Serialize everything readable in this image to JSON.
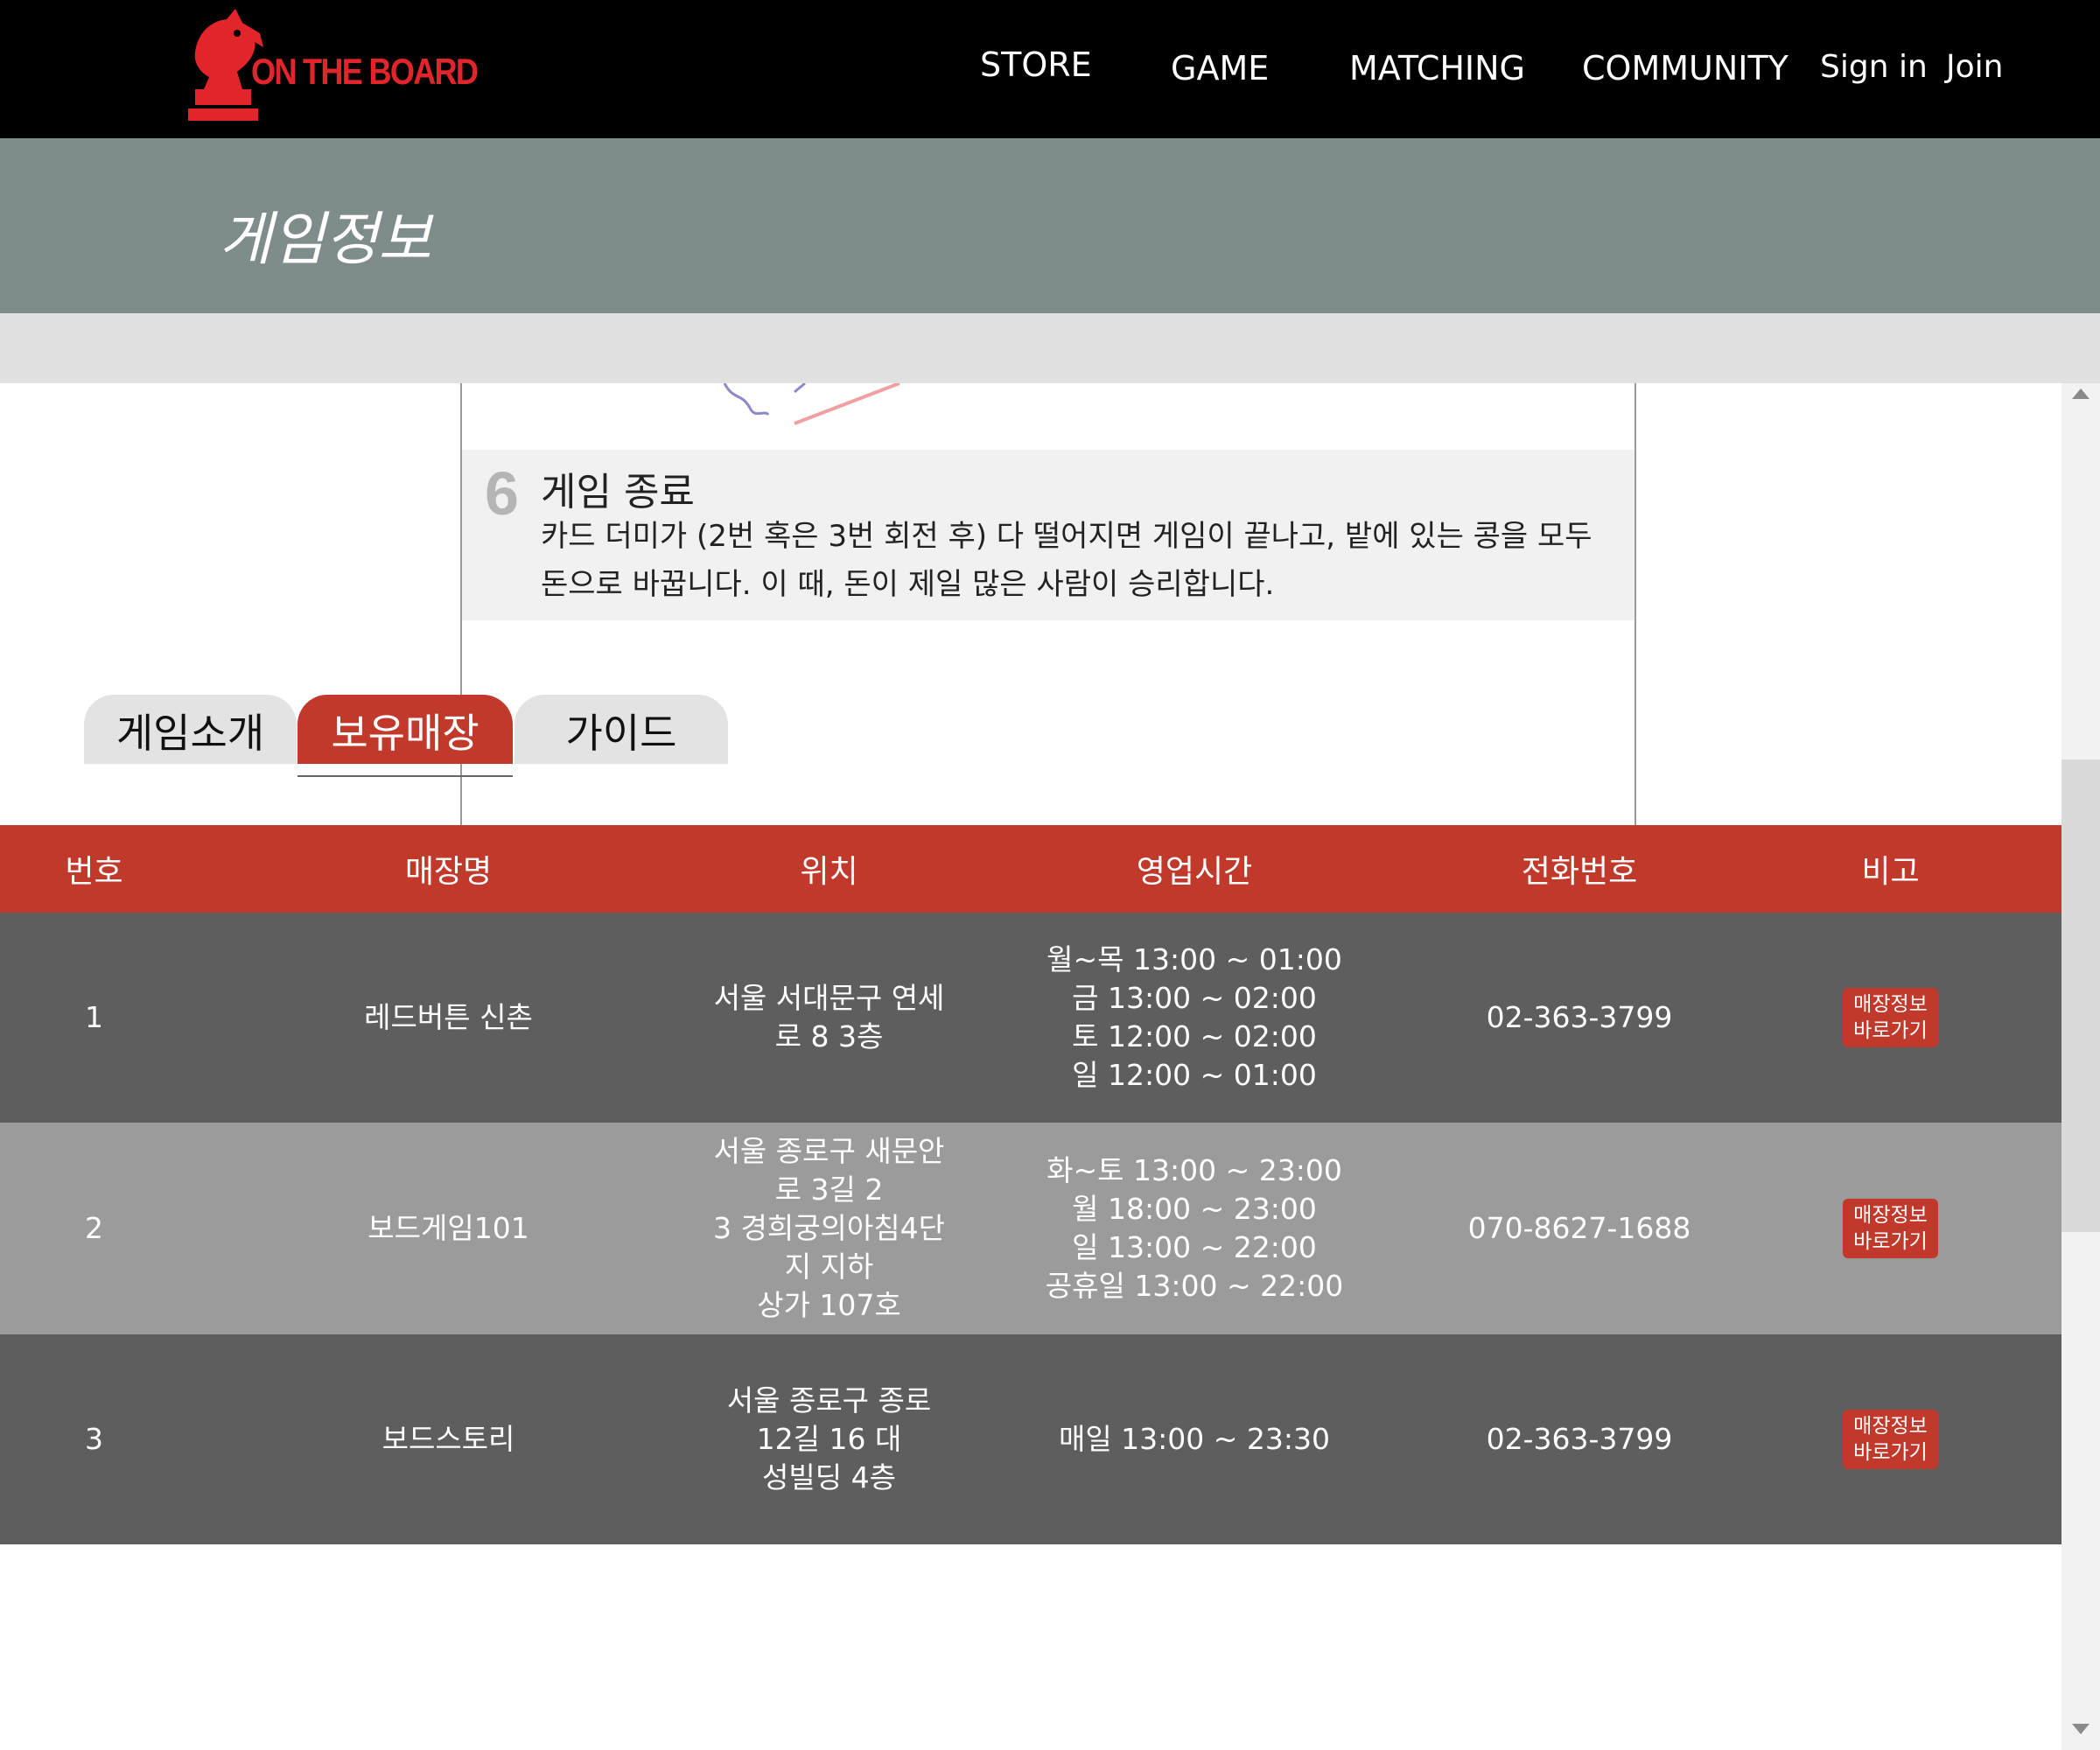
{
  "header": {
    "logo_text": "ON THE BOARD",
    "nav": [
      "STORE",
      "GAME",
      "MATCHING",
      "COMMUNITY"
    ],
    "sign_in": "Sign in",
    "join": "Join"
  },
  "page": {
    "title": "게임정보"
  },
  "guide": {
    "step_number": "6",
    "heading": "게임 종료",
    "text_line1": "카드 더미가 (2번 혹은 3번 회전 후) 다 떨어지면 게임이 끝나고, 밭에 있는 콩을 모두",
    "text_line2": "돈으로 바꿉니다. 이 때, 돈이 제일 많은 사람이 승리합니다."
  },
  "tabs": [
    "게임소개",
    "보유매장",
    "가이드"
  ],
  "table": {
    "headers": [
      "번호",
      "매장명",
      "위치",
      "영업시간",
      "전화번호",
      "비고"
    ],
    "rows": [
      {
        "no": "1",
        "name": "레드버튼 신촌",
        "location": "서울 서대문구 연세로 8 3층",
        "hours": [
          "월~목 13:00 ~ 01:00",
          "금 13:00 ~ 02:00",
          "토 12:00 ~ 02:00",
          "일 12:00 ~ 01:00"
        ],
        "phone": "02-363-3799",
        "button": [
          "매장정보",
          "바로가기"
        ]
      },
      {
        "no": "2",
        "name": "보드게임101",
        "location": [
          "서울 종로구 새문안로 3길 2",
          "3 경희궁의아침4단지 지하",
          "상가 107호"
        ],
        "hours": [
          "화~토 13:00 ~ 23:00",
          "월 18:00 ~ 23:00",
          "일 13:00 ~ 22:00",
          "공휴일 13:00 ~ 22:00"
        ],
        "phone": "070-8627-1688",
        "button": [
          "매장정보",
          "바로가기"
        ]
      },
      {
        "no": "3",
        "name": "보드스토리",
        "location": [
          "서울 종로구 종로12길 16 대",
          "성빌딩 4층"
        ],
        "hours": [
          "매일 13:00 ~ 23:30"
        ],
        "phone": "02-363-3799",
        "button": [
          "매장정보",
          "바로가기"
        ]
      }
    ]
  },
  "colors": {
    "accent": "#c0392b",
    "header_bg": "#000000",
    "title_band": "#7f8c8c",
    "row_dark": "#5e5e5e",
    "row_light": "#9b9b9b"
  }
}
